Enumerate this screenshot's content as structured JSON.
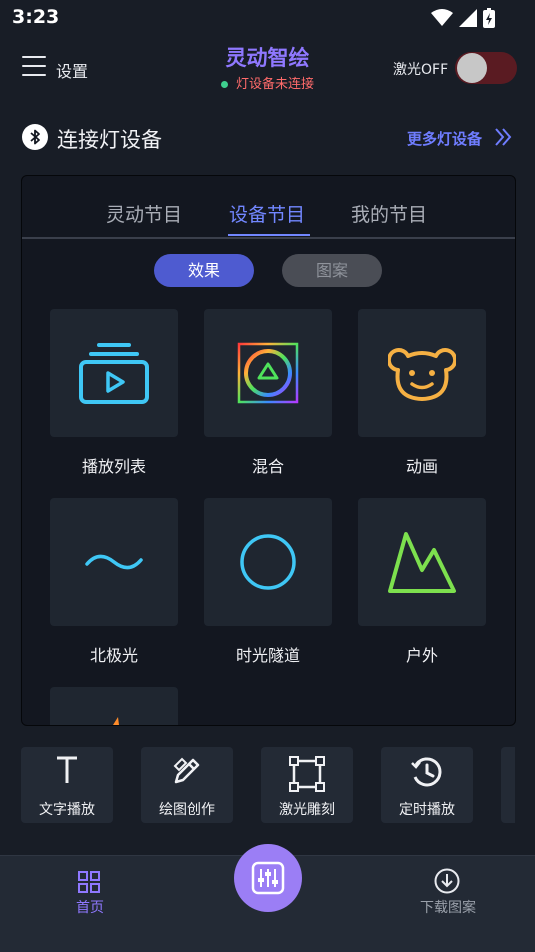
{
  "status_bar": {
    "time": "3:23"
  },
  "header": {
    "menu_label": "设置",
    "title": "灵动智绘",
    "connection_status": "灯设备未连接",
    "laser_label": "激光OFF",
    "laser_on": false
  },
  "connect": {
    "title": "连接灯设备",
    "more_link": "更多灯设备"
  },
  "tabs": [
    {
      "label": "灵动节目",
      "active": false
    },
    {
      "label": "设备节目",
      "active": true
    },
    {
      "label": "我的节目",
      "active": false
    }
  ],
  "segments": {
    "effect": "效果",
    "pattern": "图案",
    "selected": "effect"
  },
  "grid": [
    {
      "label": "播放列表",
      "icon": "playlist-icon"
    },
    {
      "label": "混合",
      "icon": "mix-icon"
    },
    {
      "label": "动画",
      "icon": "animation-bear-icon"
    },
    {
      "label": "北极光",
      "icon": "aurora-wave-icon"
    },
    {
      "label": "时光隧道",
      "icon": "tunnel-circle-icon"
    },
    {
      "label": "户外",
      "icon": "outdoor-mountain-icon"
    }
  ],
  "quick_actions": [
    {
      "label": "文字播放",
      "icon": "text-icon"
    },
    {
      "label": "绘图创作",
      "icon": "draw-icon"
    },
    {
      "label": "激光雕刻",
      "icon": "engrave-icon"
    },
    {
      "label": "定时播放",
      "icon": "timer-icon"
    }
  ],
  "bottom_nav": {
    "home": "首页",
    "download": "下载图案"
  },
  "colors": {
    "accent": "#8f78ff",
    "tab_active": "#7287ff",
    "error": "#ff6b6b",
    "background": "#181d26"
  }
}
